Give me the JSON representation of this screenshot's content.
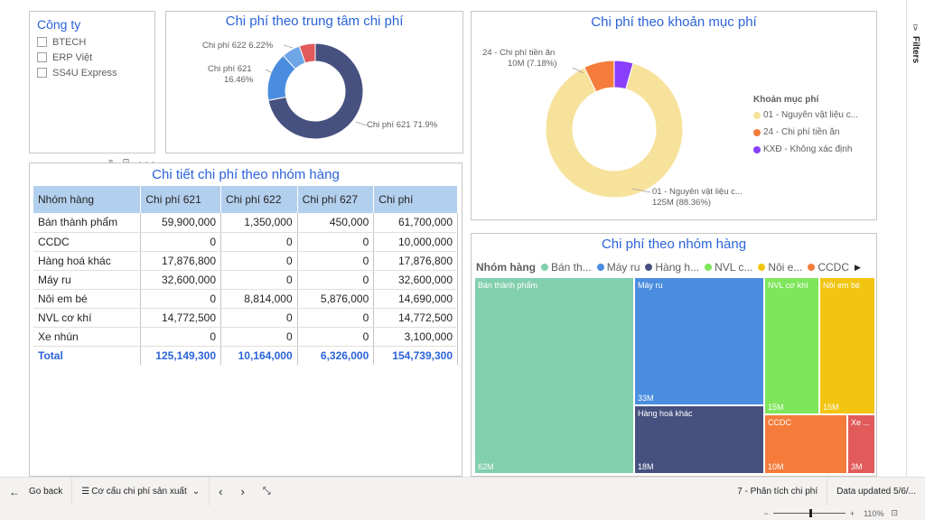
{
  "slicer": {
    "title": "Công ty",
    "items": [
      "BTECH",
      "ERP Việt",
      "SS4U Express"
    ]
  },
  "donut_center": {
    "title": "Chi phí theo trung tâm chi phí",
    "labels": {
      "c622": "Chi phí 622 6.22%",
      "c621a": "Chi phí 621",
      "c621b": "16.46%",
      "c621_main": "Chi phí 621 71.9%"
    }
  },
  "donut_item": {
    "title": "Chi phí theo khoản mục phí",
    "label_top_a": "24 - Chi phí tiền ăn",
    "label_top_b": "10M (7.18%)",
    "label_bottom_a": "01 - Nguyên vật liệu c...",
    "label_bottom_b": "125M (88.36%)",
    "legend_title": "Khoản mục phí",
    "legend": [
      {
        "label": "01 - Nguyên vật liệu c...",
        "color": "#f7e29c"
      },
      {
        "label": "24 - Chi phí tiền ăn",
        "color": "#f57c3b"
      },
      {
        "label": "KXĐ - Không xác định",
        "color": "#8a3ffc"
      }
    ]
  },
  "chart_data": [
    {
      "type": "pie",
      "title": "Chi phí theo trung tâm chi phí",
      "categories": [
        "Chi phí 621",
        "Chi phí 621",
        "Chi phí 622",
        "Chi phí 627"
      ],
      "values": [
        71.9,
        16.46,
        6.22,
        5.42
      ],
      "colors": [
        "#475180",
        "#4a8de0",
        "#6fa6e8",
        "#e15b5b"
      ]
    },
    {
      "type": "pie",
      "title": "Chi phí theo khoản mục phí",
      "categories": [
        "01 - Nguyên vật liệu c...",
        "24 - Chi phí tiền ăn",
        "KXĐ - Không xác định"
      ],
      "values": [
        88.36,
        7.18,
        4.46
      ],
      "colors": [
        "#f7e29c",
        "#f57c3b",
        "#8a3ffc"
      ]
    }
  ],
  "table": {
    "title": "Chi tiết chi phí theo nhóm hàng",
    "headers": [
      "Nhóm hàng",
      "Chi phí 621",
      "Chi phí 622",
      "Chi phí 627",
      "Chi phí"
    ],
    "rows": [
      [
        "Bán thành phẩm",
        "59,900,000",
        "1,350,000",
        "450,000",
        "61,700,000"
      ],
      [
        "CCDC",
        "0",
        "0",
        "0",
        "10,000,000"
      ],
      [
        "Hàng hoá khác",
        "17,876,800",
        "0",
        "0",
        "17,876,800"
      ],
      [
        "Máy ru",
        "32,600,000",
        "0",
        "0",
        "32,600,000"
      ],
      [
        "Nôi em bé",
        "0",
        "8,814,000",
        "5,876,000",
        "14,690,000"
      ],
      [
        "NVL cơ khí",
        "14,772,500",
        "0",
        "0",
        "14,772,500"
      ],
      [
        "Xe nhún",
        "0",
        "0",
        "0",
        "3,100,000"
      ]
    ],
    "total": [
      "Total",
      "125,149,300",
      "10,164,000",
      "6,326,000",
      "154,739,300"
    ]
  },
  "treemap": {
    "title": "Chi phí theo nhóm hàng",
    "legend_title": "Nhóm hàng",
    "legend": [
      {
        "label": "Bán th...",
        "color": "#82cfae"
      },
      {
        "label": "Máy ru",
        "color": "#4a8de0"
      },
      {
        "label": "Hàng h...",
        "color": "#475180"
      },
      {
        "label": "NVL c...",
        "color": "#7ee65a"
      },
      {
        "label": "Nôi e...",
        "color": "#f2c511"
      },
      {
        "label": "CCDC",
        "color": "#f57c3b"
      }
    ],
    "tiles": [
      {
        "name": "Bán thành phẩm",
        "value": "62M",
        "color": "#82cfae"
      },
      {
        "name": "Máy ru",
        "value": "33M",
        "color": "#4a8de0"
      },
      {
        "name": "Hàng hoá khác",
        "value": "18M",
        "color": "#475180"
      },
      {
        "name": "NVL cơ khí",
        "value": "15M",
        "color": "#7ee65a"
      },
      {
        "name": "Nôi em bé",
        "value": "15M",
        "color": "#f2c511"
      },
      {
        "name": "CCDC",
        "value": "10M",
        "color": "#f57c3b"
      },
      {
        "name": "Xe ...",
        "value": "3M",
        "color": "#e15b5b"
      }
    ]
  },
  "filters_label": "Filters",
  "bottom": {
    "go_back": "Go back",
    "page_nav": "Cơ cấu chi phí sản xuất",
    "page_info": "7 - Phân tích chi phí",
    "data_updated": "Data updated 5/6/...",
    "zoom": "110%"
  }
}
